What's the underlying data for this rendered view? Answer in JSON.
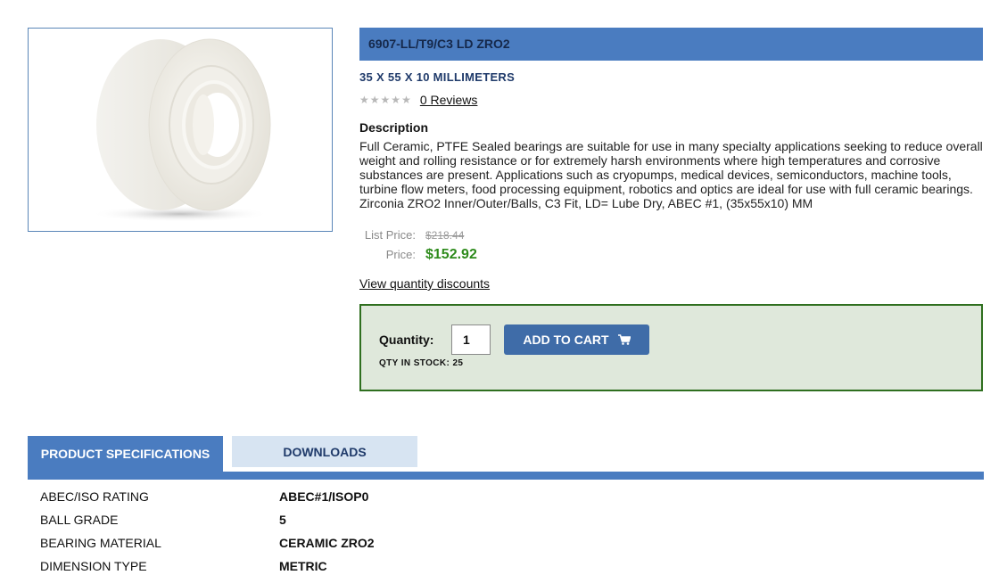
{
  "product": {
    "title": "6907-LL/T9/C3 LD ZRO2",
    "dimensions": "35 X 55 X 10 MILLIMETERS",
    "rating": 0,
    "reviews_link": "0 Reviews",
    "description_heading": "Description",
    "description": "Full Ceramic, PTFE Sealed bearings are suitable for use in many specialty applications seeking to reduce overall weight and rolling resistance or for extremely harsh environments where high temperatures and corrosive substances are present. Applications such as cryopumps, medical devices, semiconductors, machine tools, turbine flow meters, food processing equipment, robotics and optics are ideal for use with full ceramic bearings. Zirconia ZRO2 Inner/Outer/Balls, C3 Fit, LD= Lube Dry, ABEC #1, (35x55x10) MM"
  },
  "pricing": {
    "list_label": "List Price:",
    "list_value": "$218.44",
    "price_label": "Price:",
    "price_value": "$152.92",
    "discount_link": "View quantity discounts"
  },
  "cart": {
    "qty_label": "Quantity:",
    "qty_value": "1",
    "add_button": "ADD TO CART",
    "stock_text": "QTY IN STOCK: 25"
  },
  "tabs": [
    {
      "label": "PRODUCT SPECIFICATIONS",
      "active": true
    },
    {
      "label": "DOWNLOADS",
      "active": false
    }
  ],
  "specs": [
    {
      "key": "ABEC/ISO RATING",
      "value": "ABEC#1/ISOP0"
    },
    {
      "key": "BALL GRADE",
      "value": "5"
    },
    {
      "key": "BEARING MATERIAL",
      "value": "CERAMIC ZRO2"
    },
    {
      "key": "DIMENSION TYPE",
      "value": "METRIC"
    }
  ],
  "icons": {
    "star": "star-icon",
    "cart": "shopping-cart-icon"
  },
  "colors": {
    "accent": "#4a7cc0",
    "button": "#3f6ca8",
    "price_green": "#2e8b1c",
    "cart_box_bg": "#dfe8db",
    "cart_box_border": "#2f6f1f"
  }
}
